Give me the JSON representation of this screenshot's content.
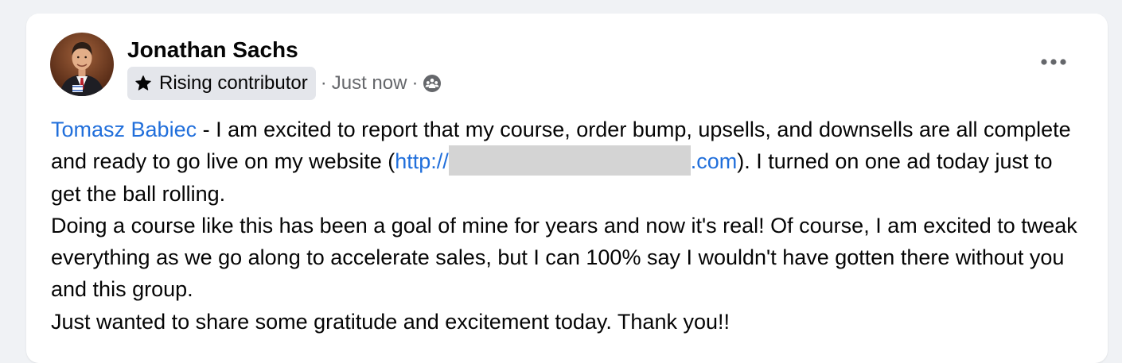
{
  "post": {
    "author_name": "Jonathan Sachs",
    "badge_label": "Rising contributor",
    "timestamp": "Just now",
    "separator": "·",
    "mention": "Tomasz Babiec",
    "para1_text_a": " - I am excited to report that my course, order bump, upsells, and downsells are all complete and ready to go live on my website (",
    "url_prefix": "http://",
    "url_suffix": ".com",
    "para1_text_b": "). I turned on one ad today just to get the ball rolling.",
    "para2": "Doing a course like this has been a goal of mine for years and now it's real! Of course, I am excited to tweak everything as we go along to accelerate sales, but I can 100% say I wouldn't have gotten there without you and this group.",
    "para3": "Just wanted to share some gratitude and excitement today. Thank you!!"
  },
  "icons": {
    "badge": "star-icon",
    "audience": "group-icon",
    "menu": "more-options-icon"
  },
  "colors": {
    "link": "#216fdb",
    "card_background": "#ffffff",
    "page_background": "#f0f2f5",
    "badge_background": "#e4e6eb",
    "muted_text": "#65676b"
  }
}
